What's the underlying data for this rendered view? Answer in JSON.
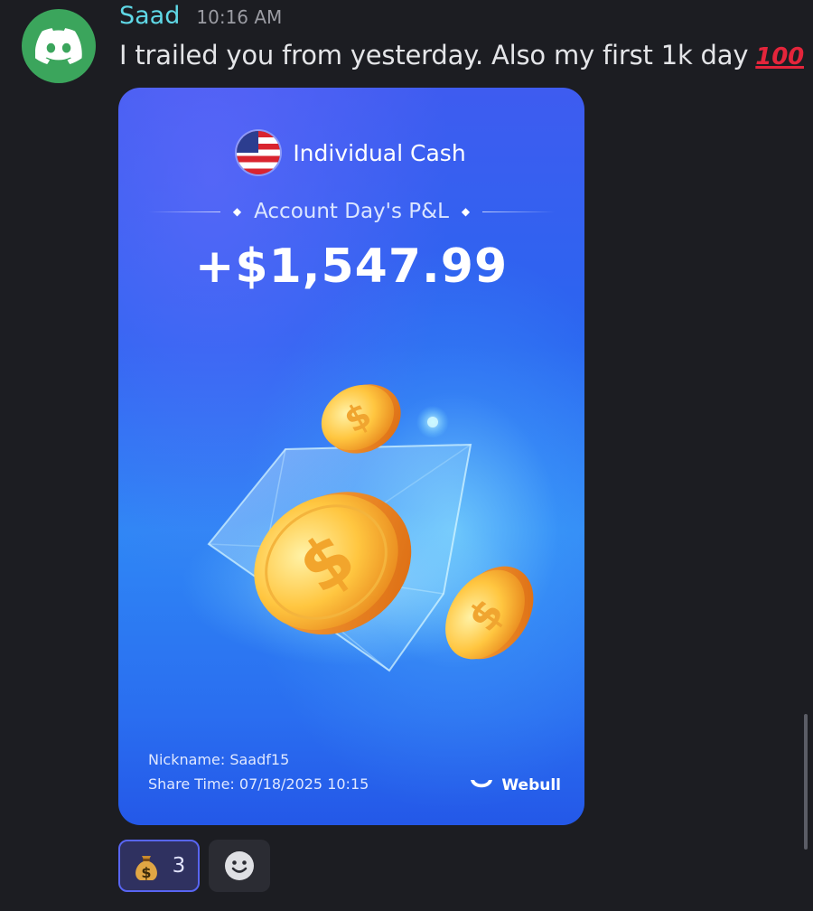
{
  "message": {
    "username": "Saad",
    "timestamp": "10:16 AM",
    "text": "I trailed you from yesterday. Also my first 1k day",
    "emoji": "100"
  },
  "card": {
    "account_type": "Individual Cash",
    "pl_label": "Account Day's P&L",
    "pl_value": "+$1,547.99",
    "nickname": "Nickname: Saadf15",
    "share_time": "Share Time: 07/18/2025 10:15",
    "brand": "Webull"
  },
  "reactions": [
    {
      "emoji": "money-bag",
      "count": "3"
    }
  ],
  "colors": {
    "background": "#1c1d22",
    "username": "#5fd8e6",
    "avatar": "#3ba55c",
    "reaction_border": "#5865f2"
  }
}
